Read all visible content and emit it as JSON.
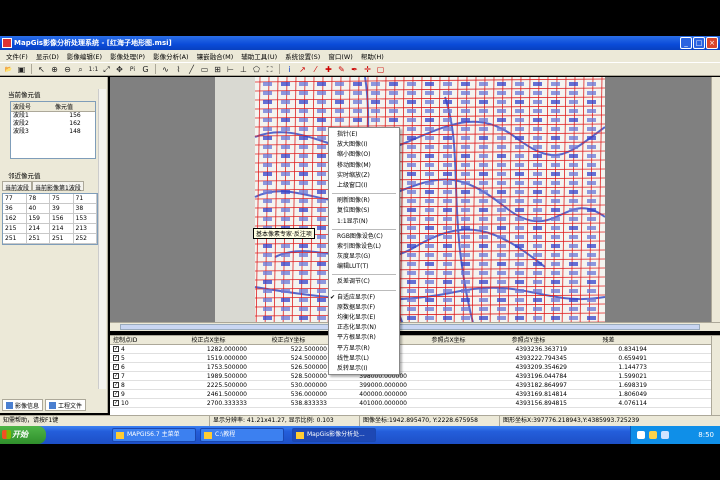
{
  "window": {
    "title": "MapGis影像分析处理系统 - [红海子地形图.msi]",
    "buttons": [
      "_",
      "□",
      "×"
    ]
  },
  "menubar": [
    "文件(F)",
    "显示(D)",
    "影像编辑(E)",
    "影像处理(P)",
    "影像分析(A)",
    "镶嵌融合(M)",
    "辅助工具(U)",
    "系统设置(S)",
    "窗口(W)",
    "帮助(H)"
  ],
  "toolbar": {
    "items": [
      {
        "icon": "open-icon",
        "glyph": "📂"
      },
      {
        "icon": "save-icon",
        "glyph": "▣"
      },
      {
        "icon": "pointer-icon",
        "glyph": "↖"
      },
      {
        "icon": "zoom-in-icon",
        "glyph": "⊕"
      },
      {
        "icon": "zoom-out-icon",
        "glyph": "⊖"
      },
      {
        "icon": "zoom-window-icon",
        "glyph": "⌕"
      },
      {
        "icon": "zoom-1to1-icon",
        "glyph": "1:1"
      },
      {
        "icon": "fit-window-icon",
        "glyph": "⤢"
      },
      {
        "icon": "pan-icon",
        "glyph": "✥"
      },
      {
        "icon": "pixel-info-icon",
        "glyph": "Pi"
      },
      {
        "icon": "georef-icon",
        "glyph": "G"
      },
      {
        "icon": "curve-icon",
        "glyph": "∿"
      },
      {
        "icon": "polyline-icon",
        "glyph": "⌇"
      },
      {
        "icon": "line-tool-icon",
        "glyph": "╱"
      },
      {
        "icon": "rect-tool-icon",
        "glyph": "▭"
      },
      {
        "icon": "grid-tool-icon",
        "glyph": "⊞"
      },
      {
        "icon": "measure-icon",
        "glyph": "⊢"
      },
      {
        "icon": "ruler-icon",
        "glyph": "⊥"
      },
      {
        "icon": "polygon-icon",
        "glyph": "⬠"
      },
      {
        "icon": "zoom-extent-icon",
        "glyph": "⛶"
      },
      {
        "icon": "info-icon",
        "glyph": "i"
      },
      {
        "icon": "cursor-icon",
        "glyph": "↗"
      },
      {
        "icon": "line-icon",
        "glyph": "⁄"
      },
      {
        "icon": "add-point-icon",
        "glyph": "✚"
      },
      {
        "icon": "edit-point-icon",
        "glyph": "✎"
      },
      {
        "icon": "pen-icon",
        "glyph": "✒"
      },
      {
        "icon": "select-point-icon",
        "glyph": "✛"
      },
      {
        "icon": "delete-point-icon",
        "glyph": "▢"
      }
    ]
  },
  "left_panel": {
    "current_pixel_title": "当前像元值",
    "band_headers": [
      "波段号",
      "像元值"
    ],
    "bands": [
      {
        "name": "波段1",
        "value": "156"
      },
      {
        "name": "波段2",
        "value": "162"
      },
      {
        "name": "波段3",
        "value": "148"
      }
    ],
    "neighbor_title": "邻近像元值",
    "neighbor_tabs": [
      "当前波段",
      "当前影像第1波段"
    ],
    "neighbor_grid": [
      [
        "77",
        "78",
        "75",
        "71"
      ],
      [
        "36",
        "40",
        "39",
        "38"
      ],
      [
        "162",
        "159",
        "156",
        "153"
      ],
      [
        "215",
        "214",
        "214",
        "213"
      ],
      [
        "251",
        "251",
        "251",
        "252"
      ]
    ],
    "bottom_tabs": [
      "影像信息",
      "工程文件"
    ]
  },
  "context_menu": {
    "groups": [
      [
        {
          "label": "指针(E)",
          "checked": false
        },
        {
          "label": "放大图像(I)",
          "checked": false
        },
        {
          "label": "缩小图像(O)",
          "checked": false
        },
        {
          "label": "移动图像(M)",
          "checked": false
        },
        {
          "label": "实时缩放(Z)",
          "checked": false
        },
        {
          "label": "上级窗口(I)",
          "checked": false
        }
      ],
      [
        {
          "label": "刷新图像(R)",
          "checked": false
        },
        {
          "label": "复位图像(S)",
          "checked": false
        },
        {
          "label": "1:1显示(N)",
          "checked": false
        }
      ],
      [
        {
          "label": "RGB图像设色(C)",
          "checked": false
        },
        {
          "label": "索引图像设色(L)",
          "checked": false
        },
        {
          "label": "灰度显示(G)",
          "checked": false
        },
        {
          "label": "编辑LUT(T)",
          "checked": false
        }
      ],
      [
        {
          "label": "反差调节(C)",
          "checked": false
        }
      ],
      [
        {
          "label": "自适应显示(F)",
          "checked": true
        },
        {
          "label": "原数据显示(F)",
          "checked": false
        },
        {
          "label": "均衡化显示(E)",
          "checked": false
        },
        {
          "label": "正态化显示(N)",
          "checked": false
        },
        {
          "label": "平方根显示(R)",
          "checked": false
        },
        {
          "label": "平方显示(R)",
          "checked": false
        },
        {
          "label": "线性显示(L)",
          "checked": false
        },
        {
          "label": "反转显示(I)",
          "checked": false
        }
      ]
    ],
    "tooltip": "基本像素专家·反注项"
  },
  "control_points": {
    "headers": [
      "控制点ID",
      "校正点X坐标",
      "校正点Y坐标",
      "",
      "参照点X坐标",
      "参照点Y坐标",
      "残差"
    ],
    "rows": [
      {
        "id": "4",
        "x": "1282.000000",
        "y": "522.500000",
        "rx": "",
        "ry": "4393236.363719",
        "res": "0.834194"
      },
      {
        "id": "5",
        "x": "1519.000000",
        "y": "524.500000",
        "rx": "",
        "ry": "4393222.794345",
        "res": "0.659491"
      },
      {
        "id": "6",
        "x": "1753.500000",
        "y": "526.500000",
        "rx": "",
        "ry": "4393209.354629",
        "res": "1.144773"
      },
      {
        "id": "7",
        "x": "1989.500000",
        "y": "528.500000",
        "rx": "398000.000000",
        "ry": "4393196.044784",
        "res": "1.599021"
      },
      {
        "id": "8",
        "x": "2225.500000",
        "y": "530.000000",
        "rx": "399000.000000",
        "ry": "4393182.864997",
        "res": "1.698319"
      },
      {
        "id": "9",
        "x": "2461.500000",
        "y": "536.000000",
        "rx": "400000.000000",
        "ry": "4393169.814814",
        "res": "1.806049"
      },
      {
        "id": "10",
        "x": "2700.333333",
        "y": "538.833333",
        "rx": "401000.000000",
        "ry": "4393156.894815",
        "res": "4.076114"
      }
    ]
  },
  "statusbar": {
    "items": [
      "知需帮助，请按F1键",
      "显示分辨率: 41.21x41.27, 显示比例: 0.103",
      "图像坐标:1942.895470, Y:2228.675958",
      "图形坐标X:397776.218943,Y:4385993.725239"
    ]
  },
  "taskbar": {
    "start": "开始",
    "tasks": [
      "MAPGIS6.7 主菜单",
      "C:\\教程",
      "MapGis影像分析处..."
    ],
    "clock": "8:50"
  },
  "colors": {
    "titlebar": "#0a4bd8",
    "chrome": "#ece9d8",
    "map_grid": "#e02020",
    "map_labels": "#3344cc",
    "taskbar": "#245edb"
  }
}
